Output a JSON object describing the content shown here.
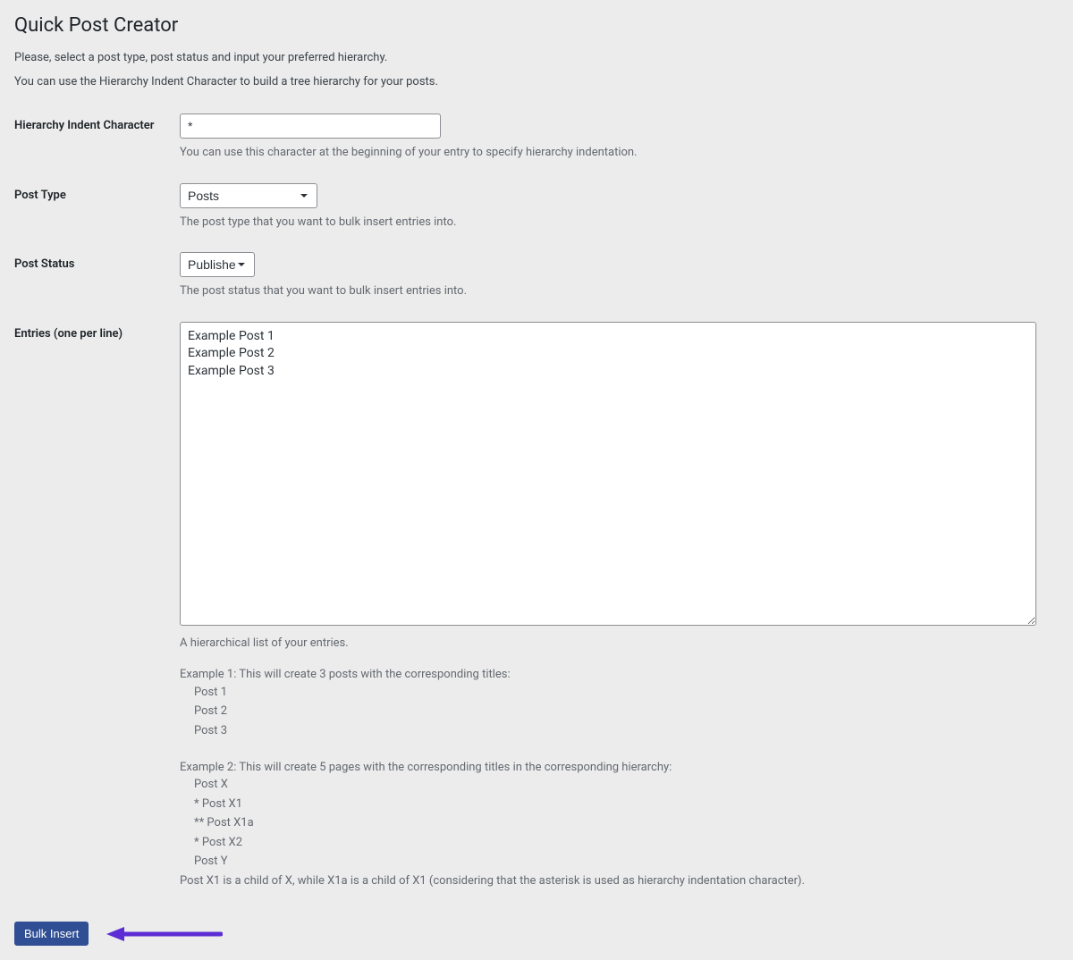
{
  "header": {
    "title": "Quick Post Creator",
    "intro1": "Please, select a post type, post status and input your preferred hierarchy.",
    "intro2": "You can use the Hierarchy Indent Character to build a tree hierarchy for your posts."
  },
  "fields": {
    "hierarchy": {
      "label": "Hierarchy Indent Character",
      "value": "*",
      "description": "You can use this character at the beginning of your entry to specify hierarchy indentation."
    },
    "post_type": {
      "label": "Post Type",
      "value": "Posts",
      "description": "The post type that you want to bulk insert entries into."
    },
    "post_status": {
      "label": "Post Status",
      "value": "Published",
      "description": "The post status that you want to bulk insert entries into."
    },
    "entries": {
      "label": "Entries (one per line)",
      "value": "Example Post 1\nExample Post 2\nExample Post 3",
      "desc_intro": "A hierarchical list of your entries.",
      "example1_title": "Example 1: This will create 3 posts with the corresponding titles:",
      "example1_line1": "Post 1",
      "example1_line2": "Post 2",
      "example1_line3": "Post 3",
      "example2_title": "Example 2: This will create 5 pages with the corresponding titles in the corresponding hierarchy:",
      "example2_line1": "Post X",
      "example2_line2": "* Post X1",
      "example2_line3": "** Post X1a",
      "example2_line4": "* Post X2",
      "example2_line5": "Post Y",
      "example2_note": "Post X1 is a child of X, while X1a is a child of X1 (considering that the asterisk is used as hierarchy indentation character)."
    }
  },
  "submit": {
    "label": "Bulk Insert"
  },
  "colors": {
    "accent": "#2f4e93",
    "arrow": "#5c2dd5"
  }
}
